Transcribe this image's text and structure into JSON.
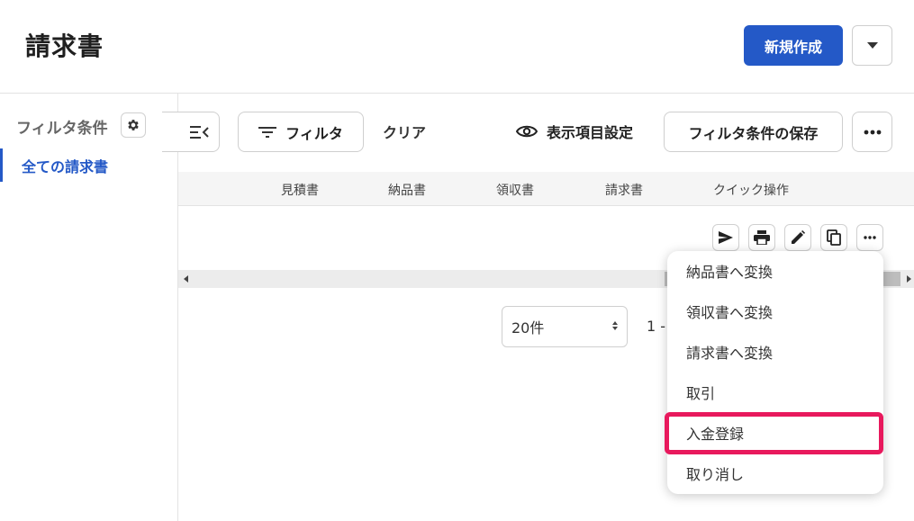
{
  "header": {
    "title": "請求書",
    "new_button": "新規作成"
  },
  "sidebar": {
    "heading": "フィルタ条件",
    "active_item": "全ての請求書"
  },
  "toolbar": {
    "filter_label": "フィルタ",
    "clear_label": "クリア",
    "display_settings_label": "表示項目設定",
    "save_filter_label": "フィルタ条件の保存"
  },
  "table": {
    "columns": [
      "見積書",
      "納品書",
      "領収書",
      "請求書",
      "クイック操作"
    ],
    "row_action_icons": [
      "send-icon",
      "print-icon",
      "edit-icon",
      "copy-icon",
      "more-icon"
    ]
  },
  "pagination": {
    "per_page": "20件",
    "range_partial": "1 -"
  },
  "context_menu": {
    "items": [
      "納品書へ変換",
      "領収書へ変換",
      "請求書へ変換",
      "取引",
      "入金登録",
      "取り消し"
    ],
    "highlighted_item": "入金登録",
    "highlight_color": "#e8195d"
  },
  "colors": {
    "accent": "#2459c7"
  }
}
